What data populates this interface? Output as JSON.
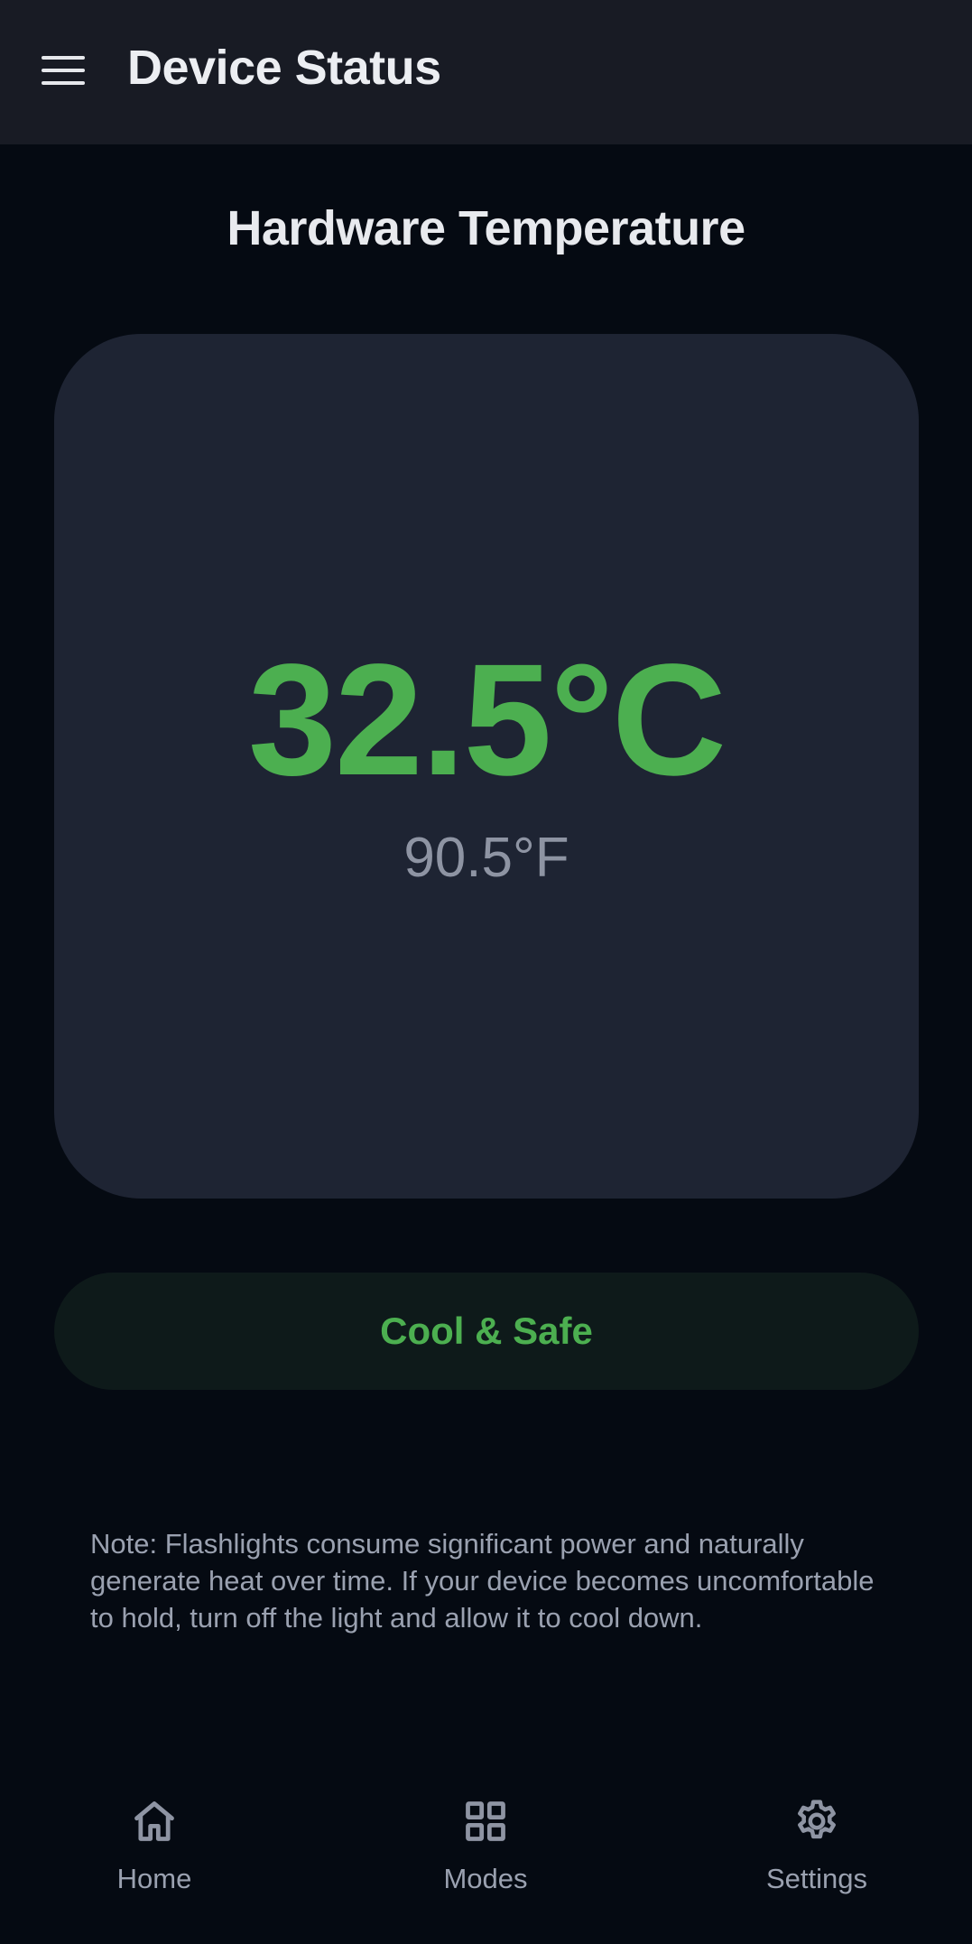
{
  "app_bar": {
    "title": "Device Status",
    "menu_icon": "hamburger-menu-icon"
  },
  "section": {
    "title": "Hardware Temperature"
  },
  "temperature": {
    "celsius": "32.5°C",
    "fahrenheit": "90.5°F"
  },
  "status": {
    "label": "Cool & Safe",
    "color": "#4caf50"
  },
  "note": {
    "text": "Note: Flashlights consume significant power and naturally generate heat over time. If your device becomes uncomfortable to hold, turn off the light and allow it to cool down."
  },
  "bottom_nav": {
    "items": [
      {
        "label": "Home",
        "icon": "home-icon"
      },
      {
        "label": "Modes",
        "icon": "grid-icon"
      },
      {
        "label": "Settings",
        "icon": "gear-icon"
      }
    ]
  },
  "colors": {
    "background": "#050a12",
    "app_bar": "#181b24",
    "card": "#1e2433",
    "accent_green": "#4caf50",
    "muted_text": "#9aa1b0"
  }
}
